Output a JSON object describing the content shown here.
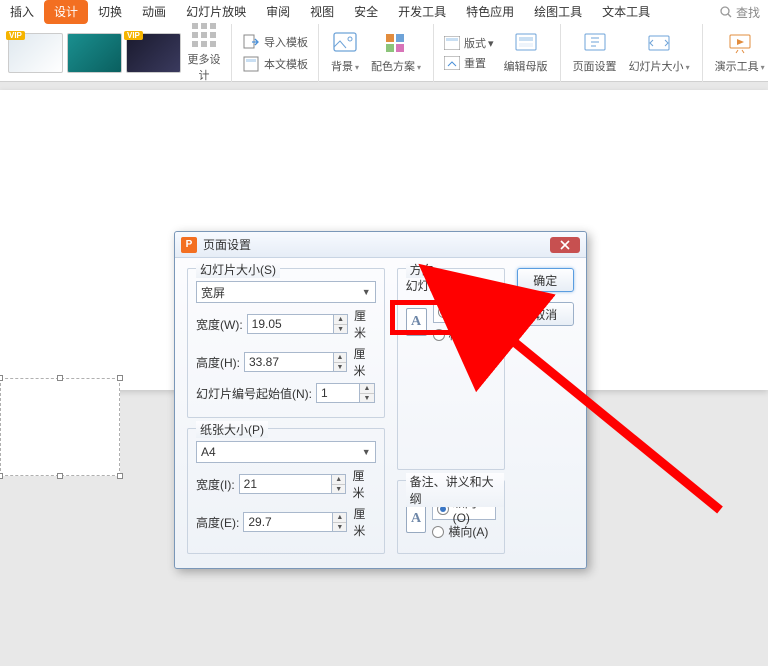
{
  "tabs": {
    "insert": "插入",
    "design": "设计",
    "transition": "切换",
    "animation": "动画",
    "slideshow": "幻灯片放映",
    "review": "审阅",
    "view": "视图",
    "security": "安全",
    "developer": "开发工具",
    "special": "特色应用",
    "drawing": "绘图工具",
    "text": "文本工具"
  },
  "search": {
    "placeholder": "查找"
  },
  "ribbon": {
    "vip": "VIP",
    "more_designs": "更多设计",
    "import_template": "导入模板",
    "local_template": "本文模板",
    "background": "背景",
    "color_scheme": "配色方案",
    "layout": "版式",
    "reset": "重置",
    "edit_master": "编辑母版",
    "page_setup": "页面设置",
    "slide_size": "幻灯片大小",
    "present_tools": "演示工具"
  },
  "dialog": {
    "title": "页面设置",
    "ok": "确定",
    "cancel": "取消",
    "slide_size_legend": "幻灯片大小(S)",
    "slide_size_value": "宽屏",
    "width_label": "宽度(W):",
    "width_value": "19.05",
    "height_label": "高度(H):",
    "height_value": "33.87",
    "number_label": "幻灯片编号起始值(N):",
    "number_value": "1",
    "unit_cm": "厘米",
    "paper_legend": "纸张大小(P)",
    "paper_value": "A4",
    "paper_width_label": "宽度(I):",
    "paper_width_value": "21",
    "paper_height_label": "高度(E):",
    "paper_height_value": "29.7",
    "orientation_legend": "方向",
    "slide_sub": "幻灯片",
    "portrait_r": "纵向(R)",
    "landscape_l": "横向(L)",
    "notes_sub": "备注、讲义和大纲",
    "portrait_o": "纵向(O)",
    "landscape_a": "横向(A)",
    "orient_letter": "A"
  }
}
